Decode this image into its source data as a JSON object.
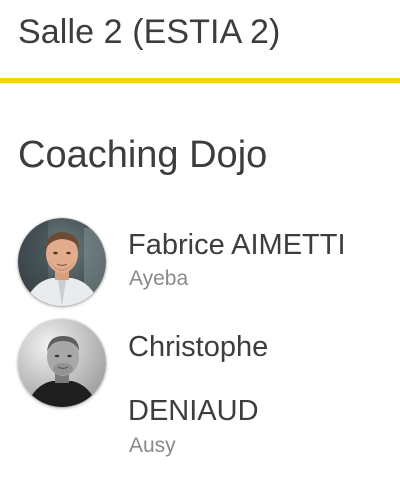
{
  "room": {
    "title": "Salle 2 (ESTIA 2)",
    "accent_color": "#f1d21d"
  },
  "session": {
    "title": "Coaching Dojo"
  },
  "speakers": [
    {
      "name": "Fabrice AIMETTI",
      "company": "Ayeba",
      "avatar": "speaker-photo"
    },
    {
      "name_line1": "Christophe",
      "name_line2": "DENIAUD",
      "company": "Ausy",
      "avatar": "speaker-photo-grayscale"
    }
  ]
}
